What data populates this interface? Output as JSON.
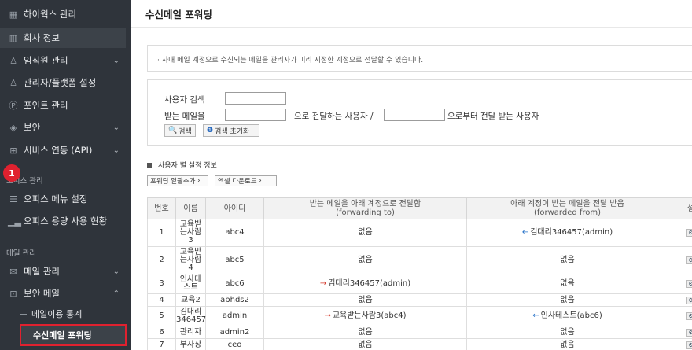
{
  "sidebar": {
    "items": [
      {
        "label": "하이웍스 관리",
        "icon": "grid-icon"
      },
      {
        "label": "회사 정보",
        "icon": "building-icon"
      },
      {
        "label": "임직원 관리",
        "icon": "user-icon"
      },
      {
        "label": "관리자/플랫폼 설정",
        "icon": "admin-icon"
      },
      {
        "label": "포인트 관리",
        "icon": "point-icon"
      },
      {
        "label": "보안",
        "icon": "shield-icon"
      },
      {
        "label": "서비스 연동 (API)",
        "icon": "api-icon"
      }
    ],
    "office_section": "오피스 관리",
    "office_items": [
      {
        "label": "오피스 메뉴 설정",
        "icon": "list-icon"
      },
      {
        "label": "오피스 용량 사용 현황",
        "icon": "chart-icon"
      }
    ],
    "mail_section": "메일 관리",
    "mail_items": [
      {
        "label": "메일 관리",
        "icon": "mail-icon"
      },
      {
        "label": "보안 메일",
        "icon": "lock-mail-icon"
      }
    ],
    "sub_items": [
      "메일이용 통계",
      "수신메일 포워딩"
    ]
  },
  "main": {
    "title": "수신메일 포워딩",
    "notice": "· 사내 메일 계정으로 수신되는 메일을 관리자가 미리 지정한 계정으로 전달할 수 있습니다.",
    "search": {
      "user_search_label": "사용자 검색",
      "receive_label": "받는 메일을",
      "forward_to_label": "으로 전달하는 사용자 /",
      "forward_from_label": "으로부터 전달 받는 사용자",
      "search_button": "검색",
      "reset_button": "검색 초기화"
    },
    "section_title": "사용자 별 설정 정보",
    "badge": "1",
    "bulk_add_button": "포워딩 일괄추가",
    "excel_button": "엑셀 다운로드"
  },
  "table": {
    "headers": [
      "번호",
      "이름",
      "아이디",
      "받는 메일을 아래 계정으로 전달함\n(forwarding to)",
      "아래 계정이 받는 메일을 전달 받음\n(forwarded from)",
      "설"
    ],
    "rows": [
      {
        "no": "1",
        "name": "교육받\n는사람\n3",
        "id": "abc4",
        "to": "없음",
        "to_arrow": "",
        "from": "김대리346457(admin)",
        "from_arrow": "←"
      },
      {
        "no": "2",
        "name": "교육받\n는사람\n4",
        "id": "abc5",
        "to": "없음",
        "to_arrow": "",
        "from": "없음",
        "from_arrow": ""
      },
      {
        "no": "3",
        "name": "인사테\n스트",
        "id": "abc6",
        "to": "김대리346457(admin)",
        "to_arrow": "→",
        "from": "없음",
        "from_arrow": ""
      },
      {
        "no": "4",
        "name": "교육2",
        "id": "abhds2",
        "to": "없음",
        "to_arrow": "",
        "from": "없음",
        "from_arrow": ""
      },
      {
        "no": "5",
        "name": "김대리\n346457",
        "id": "admin",
        "to": "교육받는사람3(abc4)",
        "to_arrow": "→",
        "from": "인사테스트(abc6)",
        "from_arrow": "←"
      },
      {
        "no": "6",
        "name": "관리자",
        "id": "admin2",
        "to": "없음",
        "to_arrow": "",
        "from": "없음",
        "from_arrow": ""
      },
      {
        "no": "7",
        "name": "부사장",
        "id": "ceo",
        "to": "없음",
        "to_arrow": "",
        "from": "없음",
        "from_arrow": ""
      }
    ]
  }
}
